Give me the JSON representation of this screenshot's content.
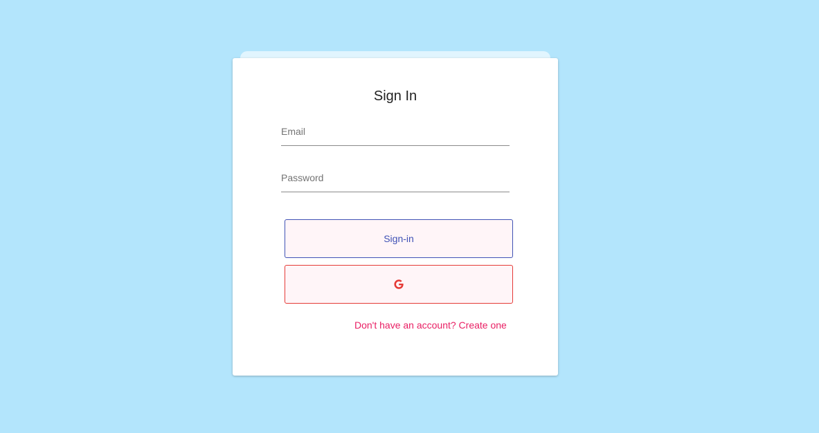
{
  "form": {
    "title": "Sign In",
    "email_placeholder": "Email",
    "email_value": "",
    "password_placeholder": "Password",
    "password_value": "",
    "signin_label": "Sign-in",
    "google_icon": "google-g-icon",
    "signup_link": "Don't have an account? Create one"
  },
  "colors": {
    "background": "#b3e5fc",
    "card": "#ffffff",
    "signin_border": "#3f51b5",
    "google_border": "#e53935",
    "link": "#e91e63"
  }
}
